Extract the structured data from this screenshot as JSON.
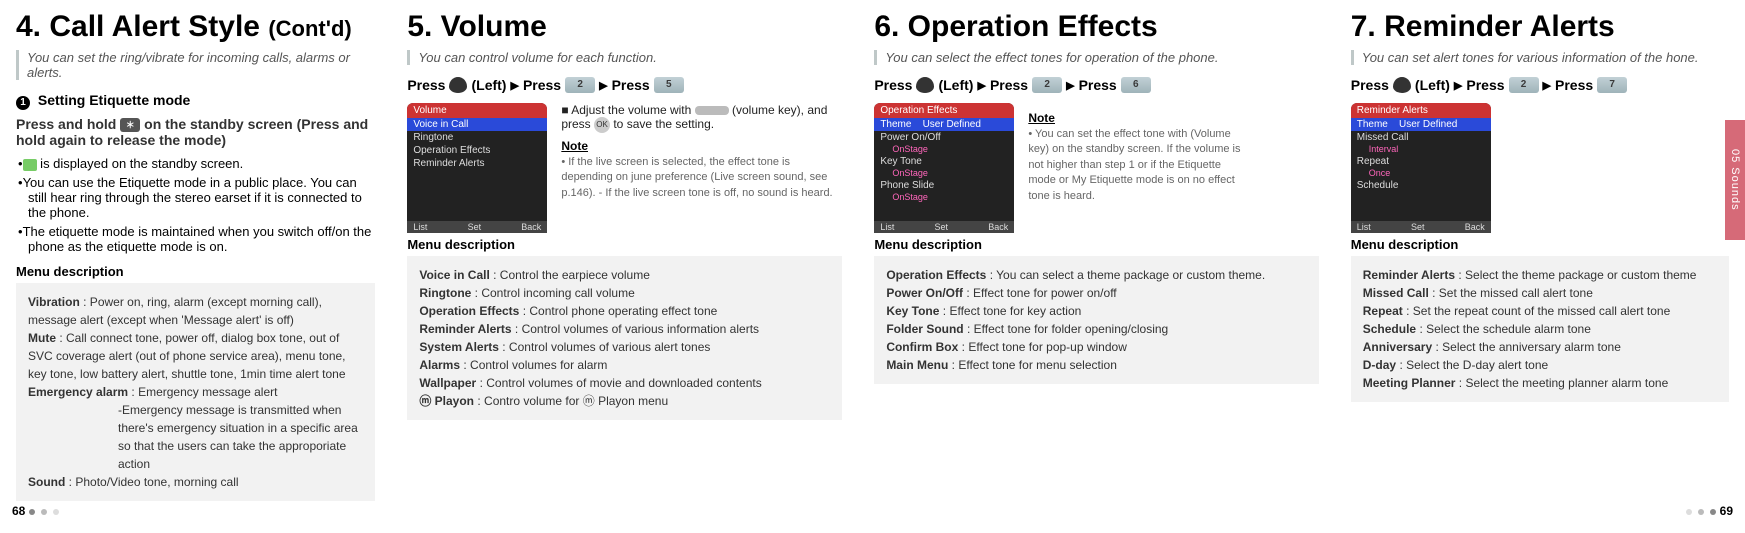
{
  "sidebar_label": "05 Sounds",
  "page_left": "68",
  "page_right": "69",
  "section4": {
    "title_main": "4. Call Alert Style ",
    "title_contd": "(Cont'd)",
    "subtitle": "You can set the ring/vibrate for incoming calls, alarms or alerts.",
    "etiquette_num": "1",
    "etiquette_title": "Setting Etiquette mode",
    "presshold_a": "Press and hold ",
    "presshold_b": " on the standby screen (Press and hold again to release the mode)",
    "bullet1_a": " is displayed on the standby screen.",
    "bullet2": "You can use the Etiquette mode in a public place. You can still hear ring through the stereo earset if it is connected to the phone.",
    "bullet3": "The etiquette mode is maintained when you switch off/on the phone as the etiquette mode is on.",
    "menu_label": "Menu description",
    "box": {
      "vibration_t": "Vibration",
      "vibration_d": ": Power on, ring, alarm (except morning call), message alert (except when 'Message alert' is off)",
      "mute_t": "Mute",
      "mute_d": ": Call connect tone, power off, dialog box tone, out of SVC coverage alert (out of phone service area), menu tone, key tone, low battery alert, shuttle tone, 1min time alert tone",
      "emerg_t": "Emergency alarm",
      "emerg_d1": ": Emergency message alert",
      "emerg_d2": "-Emergency message is transmitted when there's emergency situation in a specific area so that the users can take the approporiate action",
      "sound_t": "Sound",
      "sound_d": ": Photo/Video tone, morning call"
    }
  },
  "section5": {
    "title": "5. Volume",
    "subtitle": "You can control volume for each function.",
    "press_a": "Press ",
    "press_b": " (Left) ",
    "press_c": " Press ",
    "press_d": " Press ",
    "key2": "2",
    "key5": "5",
    "adjust": "Adjust the volume with ",
    "adjust2": " (volume key), and press ",
    "adjust3": " to save the setting.",
    "note_label": "Note",
    "note_text": "If the live screen is selected, the effect tone is depending on june preference (Live screen sound, see p.146).\n- If the live screen tone is off, no sound is heard.",
    "menu_label": "Menu description",
    "box": {
      "i1_t": "Voice in Call",
      "i1_d": ": Control the earpiece volume",
      "i2_t": "Ringtone",
      "i2_d": ": Control incoming call volume",
      "i3_t": "Operation Effects",
      "i3_d": ": Control phone operating effect tone",
      "i4_t": "Reminder Alerts",
      "i4_d": ": Control volumes of various information alerts",
      "i5_t": "System Alerts",
      "i5_d": ": Control volumes of various alert tones",
      "i6_t": "Alarms",
      "i6_d": ": Control volumes for alarm",
      "i7_t": "Wallpaper",
      "i7_d": ": Control volumes of movie and downloaded contents",
      "i8_t": "ⓜ Playon",
      "i8_d": ": Contro volume for ⓜ Playon menu"
    },
    "shot": {
      "hdr": "Volume",
      "r1": "Voice in Call",
      "r2": "Ringtone",
      "r3": "Operation Effects",
      "r4": "Reminder Alerts",
      "f1": "List",
      "f2": "Set",
      "f3": "Back"
    }
  },
  "section6": {
    "title": "6. Operation Effects",
    "subtitle": "You can select the effect tones for operation of the phone.",
    "press_a": "Press ",
    "press_b": " (Left) ",
    "press_c": " Press ",
    "press_d": " Press ",
    "key2": "2",
    "key6": "6",
    "note_label": "Note",
    "note_text": "You can set the effect tone with               (Volume key) on the standby screen. If the volume is not higher than step 1 or if the Etiquette mode or My Etiquette mode is on no effect tone is heard.",
    "menu_label": "Menu description",
    "box": {
      "i1_t": "Operation Effects",
      "i1_d": ": You can select a theme package or custom theme.",
      "i2_t": "Power On/Off",
      "i2_d": ": Effect tone for power on/off",
      "i3_t": "Key Tone",
      "i3_d": ": Effect tone for key action",
      "i4_t": "Folder Sound",
      "i4_d": ": Effect tone for folder opening/closing",
      "i5_t": "Confirm Box",
      "i5_d": ": Effect tone for pop-up window",
      "i6_t": "Main Menu",
      "i6_d": ": Effect tone for menu selection"
    },
    "shot": {
      "hdr": "Operation Effects",
      "r1": "Theme",
      "r1b": "User Defined",
      "r2": "Power On/Off",
      "r2s": "OnStage",
      "r3": "Key Tone",
      "r3s": "OnStage",
      "r4": "Phone Slide",
      "r4s": "OnStage",
      "f1": "List",
      "f2": "Set",
      "f3": "Back"
    }
  },
  "section7": {
    "title": "7. Reminder Alerts",
    "subtitle": "You can set alert tones for various information of the hone.",
    "press_a": "Press ",
    "press_b": " (Left) ",
    "press_c": " Press ",
    "press_d": " Press ",
    "key2": "2",
    "key7": "7",
    "menu_label": "Menu description",
    "box": {
      "i1_t": "Reminder Alerts",
      "i1_d": ": Select the theme package or custom theme",
      "i2_t": "Missed Call",
      "i2_d": ": Set the missed call alert tone",
      "i3_t": "Repeat",
      "i3_d": ": Set the repeat count of the missed call alert tone",
      "i4_t": "Schedule",
      "i4_d": ": Select the schedule alarm tone",
      "i5_t": "Anniversary",
      "i5_d": ": Select the anniversary alarm tone",
      "i6_t": "D-day",
      "i6_d": ": Select the D-day alert tone",
      "i7_t": "Meeting Planner",
      "i7_d": ": Select the meeting planner alarm tone"
    },
    "shot": {
      "hdr": "Reminder Alerts",
      "r1": "Theme",
      "r1b": "User Defined",
      "r2": "Missed Call",
      "r2s": "Interval",
      "r3": "Repeat",
      "r3s": "Once",
      "r4": "Schedule",
      "f1": "List",
      "f2": "Set",
      "f3": "Back"
    }
  }
}
